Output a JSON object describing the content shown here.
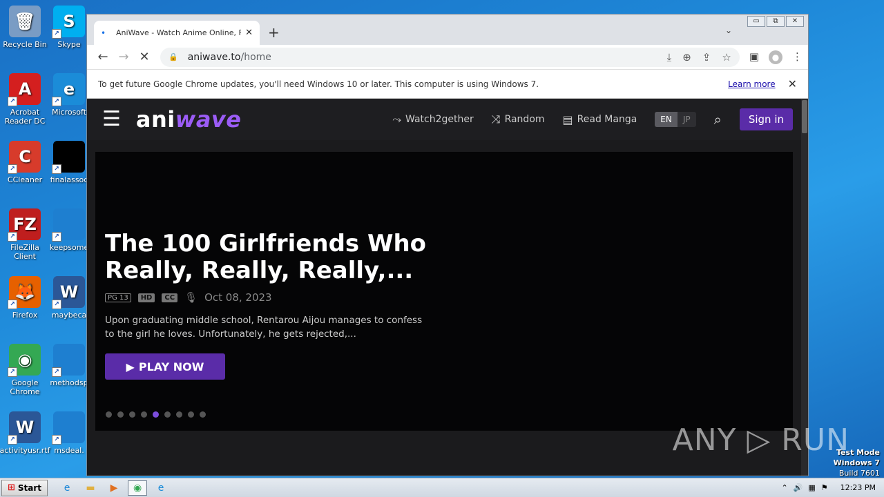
{
  "desktop_icons": [
    {
      "label": "Recycle Bin",
      "icon": "recycle-bin-icon",
      "glyph": "🗑",
      "color": "#7a9cc4"
    },
    {
      "label": "Skype",
      "icon": "skype-icon",
      "glyph": "S",
      "color": "#00aff0"
    },
    {
      "label": "Acrobat Reader DC",
      "icon": "acrobat-icon",
      "glyph": "A",
      "color": "#d41f1f"
    },
    {
      "label": "Microsoft",
      "icon": "edge-icon",
      "glyph": "e",
      "color": "#1b8cd8"
    },
    {
      "label": "CCleaner",
      "icon": "ccleaner-icon",
      "glyph": "C",
      "color": "#d73b2b"
    },
    {
      "label": "finalassoc",
      "icon": "black-file-icon",
      "glyph": "",
      "color": "#000000"
    },
    {
      "label": "FileZilla Client",
      "icon": "filezilla-icon",
      "glyph": "FZ",
      "color": "#bf1e1e"
    },
    {
      "label": "keepsome",
      "icon": "blank-file-icon",
      "glyph": "",
      "color": "#1e7fd0"
    },
    {
      "label": "Firefox",
      "icon": "firefox-icon",
      "glyph": "🦊",
      "color": "#e66000"
    },
    {
      "label": "maybeca",
      "icon": "word-doc-icon",
      "glyph": "W",
      "color": "#2b5797"
    },
    {
      "label": "Google Chrome",
      "icon": "chrome-icon",
      "glyph": "◉",
      "color": "#34a853"
    },
    {
      "label": "methodsp",
      "icon": "blank-file-icon",
      "glyph": "",
      "color": "#1e7fd0"
    },
    {
      "label": "activityusr.rtf",
      "icon": "word-doc-icon",
      "glyph": "W",
      "color": "#2b5797"
    },
    {
      "label": "msdeal.",
      "icon": "blank-file-icon",
      "glyph": "",
      "color": "#1e7fd0"
    }
  ],
  "browser": {
    "window_controls": [
      "▭",
      "⧉",
      "✕"
    ],
    "tab": {
      "favicon": "•",
      "title": "AniWave - Watch Anime Online, Free",
      "close": "✕"
    },
    "new_tab": "+",
    "tab_list": "⌄",
    "back": "←",
    "forward": "→",
    "reload": "✕",
    "url_host": "aniwave.to",
    "url_path": "/home",
    "omni_icons": [
      "⤓",
      "⊕",
      "⇪",
      "☆"
    ],
    "side_panel": "▣",
    "avatar": "●",
    "menu": "⋮",
    "infobar": {
      "message": "To get future Google Chrome updates, you'll need Windows 10 or later. This computer is using Windows 7.",
      "learn_more": "Learn more",
      "close": "✕"
    }
  },
  "site": {
    "menu_icon": "☰",
    "logo_part1": "ani",
    "logo_part2": "wave",
    "nav": [
      {
        "label": "Watch2gether",
        "glyph": "⤳",
        "icon": "watch2gether-icon"
      },
      {
        "label": "Random",
        "glyph": "⤨",
        "icon": "random-icon"
      },
      {
        "label": "Read Manga",
        "glyph": "▤",
        "icon": "manga-icon"
      }
    ],
    "lang": [
      "EN",
      "JP"
    ],
    "search_glyph": "⌕",
    "sign_in": "Sign in"
  },
  "hero": {
    "title": "The 100 Girlfriends Who Really, Really, Really,...",
    "rating": "PG 13",
    "quality": "HD",
    "cc": "CC",
    "mic": "🎙",
    "date": "Oct 08, 2023",
    "description": "Upon graduating middle school, Rentarou Aijou manages to confess to the girl he loves. Unfortunately, he gets rejected,...",
    "play_glyph": "▶",
    "play_label": "PLAY NOW",
    "slide_count": 9,
    "active_slide": 4
  },
  "watermark": "ANY ▷ RUN",
  "testmode": {
    "line1": "Test Mode",
    "line2": "Windows 7",
    "line3": "Build 7601"
  },
  "taskbar": {
    "start": "Start",
    "start_glyph": "⊞",
    "apps": [
      {
        "icon": "ie-icon",
        "glyph": "e",
        "color": "#1e88d8"
      },
      {
        "icon": "explorer-icon",
        "glyph": "▬",
        "color": "#e0b040"
      },
      {
        "icon": "media-player-icon",
        "glyph": "▶",
        "color": "#e07020"
      },
      {
        "icon": "chrome-taskbar-icon",
        "glyph": "◉",
        "color": "#34a853"
      },
      {
        "icon": "edge-taskbar-icon",
        "glyph": "e",
        "color": "#1b8cd8"
      }
    ],
    "tray": [
      "⌃",
      "🔊",
      "▦",
      "⚑"
    ],
    "clock": "12:23 PM"
  }
}
